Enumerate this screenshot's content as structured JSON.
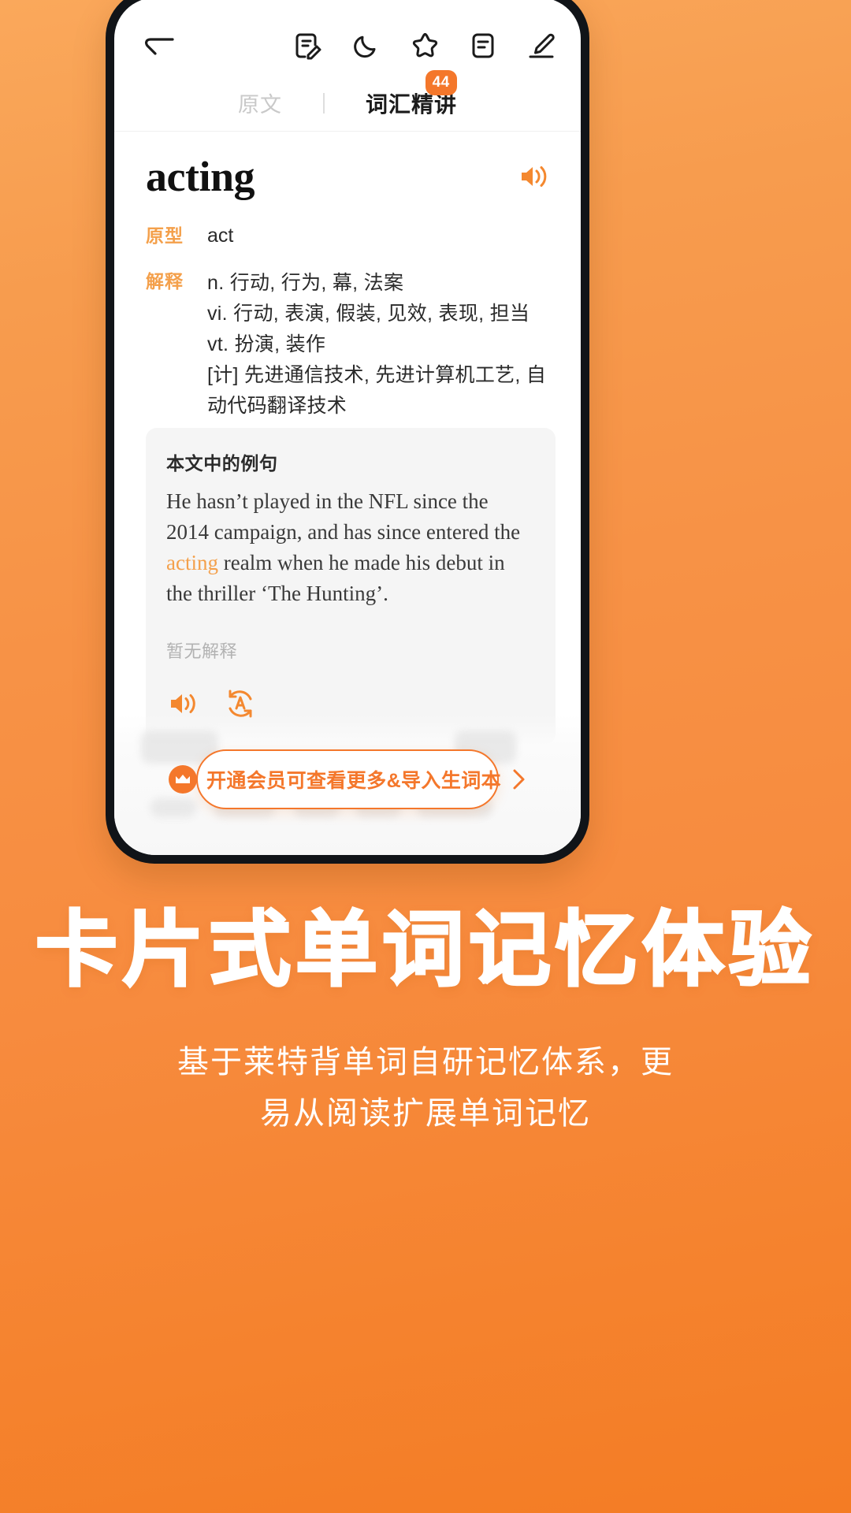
{
  "toolbar": {
    "back_icon": "back-arrow-icon",
    "icons": [
      {
        "name": "note-edit-icon",
        "label": "笔记"
      },
      {
        "name": "moon-icon",
        "label": "夜间模式"
      },
      {
        "name": "star-icon",
        "label": "收藏"
      },
      {
        "name": "list-icon",
        "label": "目录"
      },
      {
        "name": "pen-underline-icon",
        "label": "标注"
      }
    ]
  },
  "tabs": {
    "items": [
      {
        "label": "原文",
        "active": false,
        "badge": ""
      },
      {
        "label": "词汇精讲",
        "active": true,
        "badge": "44"
      }
    ]
  },
  "word": {
    "headword": "acting",
    "speaker_icon": "speaker-icon"
  },
  "definitions": {
    "prototype_label": "原型",
    "prototype_value": "act",
    "explain_label": "解释",
    "explain_lines": [
      "n. 行动, 行为, 幕, 法案",
      "vi. 行动, 表演, 假装, 见效, 表现, 担当",
      "vt. 扮演, 装作",
      "[计] 先进通信技术, 先进计算机工艺, 自动代码翻译技术"
    ]
  },
  "example_card": {
    "title": "本文中的例句",
    "sentence_pre": "He hasn’t played in the NFL since the 2014 campaign, and has since entered the ",
    "sentence_highlight": "acting",
    "sentence_post": " realm when he made his debut in the thriller ‘The Hunting’.",
    "no_translation": "暂无解释",
    "icons": [
      {
        "name": "speaker-icon",
        "label": "朗读"
      },
      {
        "name": "translate-icon",
        "label": "翻译"
      }
    ]
  },
  "cta": {
    "crown_icon": "crown-icon",
    "label": "开通会员可查看更多&导入生词本",
    "arrow_icon": "chevron-right-icon"
  },
  "promo": {
    "headline": "卡片式单词记忆体验",
    "subtitle_line1": "基于莱特背单词自研记忆体系，更",
    "subtitle_line2": "易从阅读扩展单词记忆"
  },
  "colors": {
    "accent_orange": "#F4772B",
    "label_orange": "#F4A04B",
    "bg_gradient_start": "#FAA85B",
    "bg_gradient_end": "#F47C24"
  }
}
